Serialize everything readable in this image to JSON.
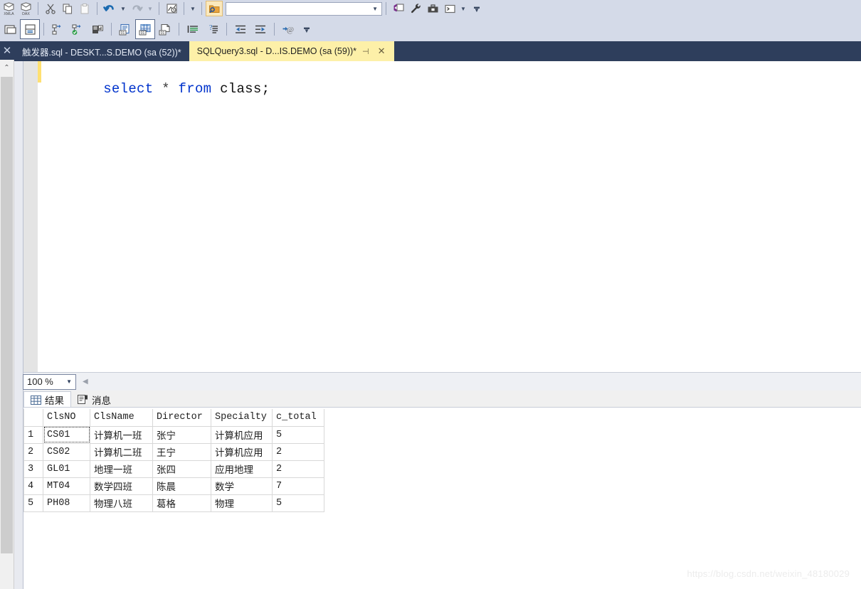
{
  "toolbar": {
    "row1": [
      {
        "id": "xmla",
        "name": "xmla-query-icon",
        "label": "XMLA",
        "type": "icon"
      },
      {
        "id": "dax",
        "name": "dax-query-icon",
        "label": "DAX",
        "type": "icon"
      },
      {
        "id": "sep1",
        "type": "sep"
      },
      {
        "id": "cut",
        "name": "cut-icon",
        "type": "icon"
      },
      {
        "id": "copy",
        "name": "copy-icon",
        "type": "icon"
      },
      {
        "id": "paste",
        "name": "paste-icon",
        "type": "icon"
      },
      {
        "id": "sep2",
        "type": "sep"
      },
      {
        "id": "undo",
        "name": "undo-icon",
        "type": "icon"
      },
      {
        "id": "undo-caret",
        "name": "undo-dropdown-caret-icon",
        "type": "caret"
      },
      {
        "id": "redo",
        "name": "redo-icon",
        "type": "icon"
      },
      {
        "id": "redo-caret",
        "name": "redo-dropdown-caret-icon",
        "type": "caret-dim"
      },
      {
        "id": "sep3",
        "type": "sep"
      },
      {
        "id": "execute-plan",
        "name": "execution-plan-icon",
        "type": "icon"
      },
      {
        "id": "sep4",
        "type": "sep"
      },
      {
        "id": "filter-caret",
        "name": "filter-dropdown-caret-icon",
        "type": "caret"
      },
      {
        "id": "sep5",
        "type": "sep"
      },
      {
        "id": "find-folder",
        "name": "find-in-files-icon",
        "type": "icon"
      }
    ],
    "combo_value": "",
    "row1_right": [
      {
        "id": "vs-window",
        "name": "visual-studio-window-icon"
      },
      {
        "id": "wrench",
        "name": "wrench-settings-icon"
      },
      {
        "id": "toolbox",
        "name": "toolbox-icon"
      },
      {
        "id": "console",
        "name": "command-prompt-icon"
      },
      {
        "id": "caret",
        "name": "more-tools-caret-icon"
      }
    ],
    "row2": [
      {
        "id": "windows",
        "name": "window-layout-icon",
        "selected": false
      },
      {
        "id": "splitter",
        "name": "split-window-icon",
        "selected": true
      },
      {
        "id": "sep1",
        "type": "sep"
      },
      {
        "id": "parse",
        "name": "parse-query-icon",
        "selected": false
      },
      {
        "id": "check",
        "name": "check-syntax-icon",
        "selected": false
      },
      {
        "id": "db-report",
        "name": "database-report-icon",
        "selected": false
      },
      {
        "id": "sep2",
        "type": "sep"
      },
      {
        "id": "results-text",
        "name": "results-to-text-icon",
        "selected": false
      },
      {
        "id": "results-grid",
        "name": "results-to-grid-icon",
        "selected": true
      },
      {
        "id": "results-file",
        "name": "results-to-file-icon",
        "selected": false
      },
      {
        "id": "sep3",
        "type": "sep"
      },
      {
        "id": "comment",
        "name": "comment-lines-icon",
        "selected": false
      },
      {
        "id": "uncomment",
        "name": "uncomment-lines-icon",
        "selected": false
      },
      {
        "id": "sep4",
        "type": "sep"
      },
      {
        "id": "outdent",
        "name": "decrease-indent-icon",
        "selected": false
      },
      {
        "id": "indent",
        "name": "increase-indent-icon",
        "selected": false
      },
      {
        "id": "sep5",
        "type": "sep"
      },
      {
        "id": "specify-values",
        "name": "specify-values-for-template-parameters-icon",
        "selected": false
      }
    ]
  },
  "tabs": [
    {
      "title": "触发器.sql - DESKT...S.DEMO (sa (52))*",
      "active": false
    },
    {
      "title": "SQLQuery3.sql - D...IS.DEMO (sa (59))*",
      "active": true
    }
  ],
  "tab_controls": {
    "pin": "⊣",
    "close": "✕"
  },
  "left_panel": {
    "close": "✕",
    "scroll_up": "⌃"
  },
  "editor": {
    "code_tokens": [
      {
        "text": "select",
        "cls": "kw"
      },
      {
        "text": " ",
        "cls": "op"
      },
      {
        "text": "*",
        "cls": "op"
      },
      {
        "text": " ",
        "cls": "op"
      },
      {
        "text": "from",
        "cls": "kw"
      },
      {
        "text": " ",
        "cls": "op"
      },
      {
        "text": "class;",
        "cls": "id"
      }
    ],
    "code_plain": "select * from class;"
  },
  "zoom_bar": {
    "value": "100 %",
    "arrow": "▼",
    "nav": "◀"
  },
  "result_tabs": [
    {
      "label": "结果",
      "icon": "grid-icon",
      "active": true
    },
    {
      "label": "消息",
      "icon": "message-icon",
      "active": false
    }
  ],
  "results_grid": {
    "columns": [
      "ClsNO",
      "ClsName",
      "Director",
      "Specialty",
      "c_total"
    ],
    "rows": [
      {
        "n": "1",
        "ClsNO": "CS01",
        "ClsName": "计算机一班",
        "Director": "张宁",
        "Specialty": "计算机应用",
        "c_total": "5"
      },
      {
        "n": "2",
        "ClsNO": "CS02",
        "ClsName": "计算机二班",
        "Director": "王宁",
        "Specialty": "计算机应用",
        "c_total": "2"
      },
      {
        "n": "3",
        "ClsNO": "GL01",
        "ClsName": "地理一班",
        "Director": "张四",
        "Specialty": "应用地理",
        "c_total": "2"
      },
      {
        "n": "4",
        "ClsNO": "MT04",
        "ClsName": "数学四班",
        "Director": "陈晨",
        "Specialty": "数学",
        "c_total": "7"
      },
      {
        "n": "5",
        "ClsNO": "PH08",
        "ClsName": "物理八班",
        "Director": "葛格",
        "Specialty": "物理",
        "c_total": "5"
      }
    ],
    "selected_cell": {
      "row": 0,
      "column": "ClsNO"
    }
  },
  "watermark": "https://blog.csdn.net/weixin_48180029",
  "colors": {
    "tabbar_bg": "#2e3e5c",
    "active_tab_bg": "#fdf0a8",
    "toolbar_bg": "#d4dae8",
    "keyword": "#0033cc",
    "changebar": "#ffe072"
  }
}
